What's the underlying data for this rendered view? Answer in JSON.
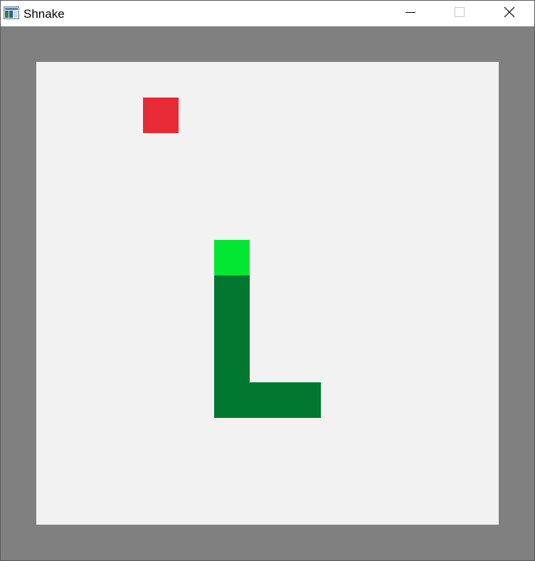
{
  "window": {
    "title": "Shnake"
  },
  "colors": {
    "frame": "#808080",
    "board": "#f2f2f2",
    "food": "#e82936",
    "snake_head": "#03e632",
    "snake_body": "#017730"
  },
  "game": {
    "grid_columns": 13,
    "grid_rows": 13,
    "food": {
      "col": 3,
      "row": 1
    },
    "snake": [
      {
        "col": 5,
        "row": 5,
        "part": "head"
      },
      {
        "col": 5,
        "row": 6,
        "part": "body"
      },
      {
        "col": 5,
        "row": 7,
        "part": "body"
      },
      {
        "col": 5,
        "row": 8,
        "part": "body"
      },
      {
        "col": 5,
        "row": 9,
        "part": "body"
      },
      {
        "col": 6,
        "row": 9,
        "part": "body"
      },
      {
        "col": 7,
        "row": 9,
        "part": "body"
      }
    ]
  }
}
